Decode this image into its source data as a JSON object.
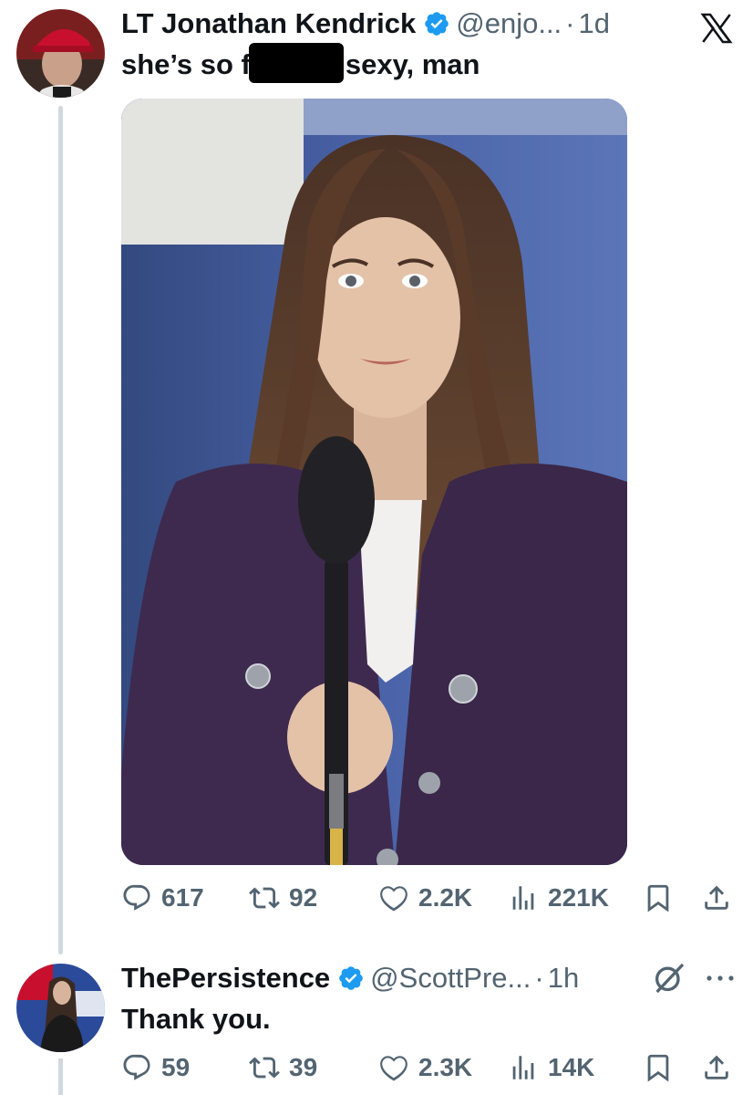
{
  "tweet1": {
    "author_name": "LT Jonathan Kendrick",
    "handle": "@enjo...",
    "separator": "·",
    "time": "1d",
    "text_before": "she’s so f",
    "text_after": "sexy, man",
    "metrics": {
      "replies": "617",
      "retweets": "92",
      "likes": "2.2K",
      "views": "221K"
    },
    "avatar_icon": "avatar-red-cap-man",
    "media_icon": "photo-reporter-with-microphone"
  },
  "tweet2": {
    "author_name": "ThePersistence",
    "handle": "@ScottPre...",
    "separator": "·",
    "time": "1h",
    "text": "Thank you.",
    "metrics": {
      "replies": "59",
      "retweets": "39",
      "likes": "2.3K",
      "views": "14K"
    },
    "avatar_icon": "avatar-speaker-at-podium"
  },
  "colors": {
    "text_primary": "#0f1419",
    "text_secondary": "#536471",
    "verified_blue": "#1d9bf0",
    "thread_line": "#cfd9de"
  }
}
